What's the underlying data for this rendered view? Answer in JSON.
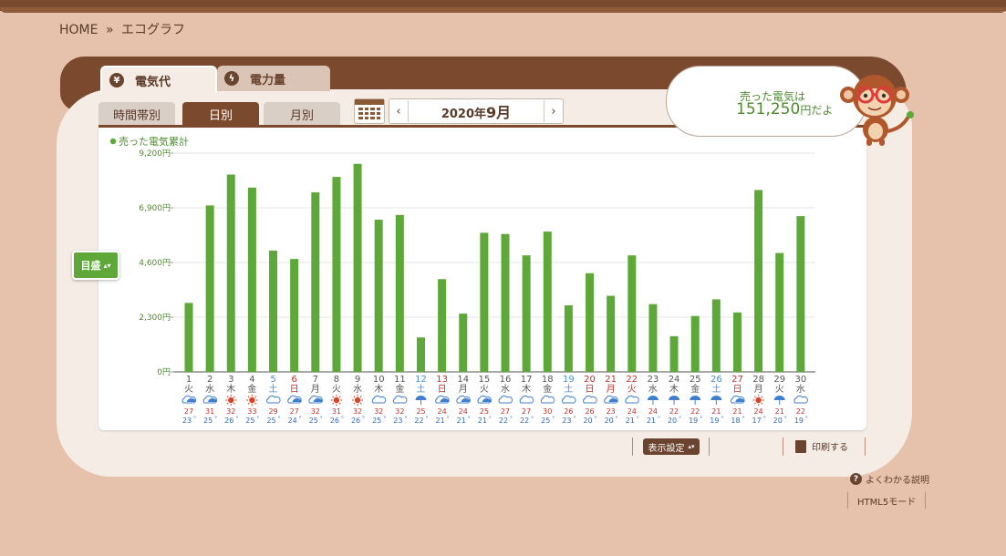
{
  "breadcrumb": {
    "home": "HOME",
    "separator": "»",
    "current": "エコグラフ"
  },
  "tabs": [
    {
      "label": "電気代",
      "icon": "yen-icon",
      "active": true
    },
    {
      "label": "電力量",
      "icon": "lightning-icon",
      "active": false
    }
  ],
  "subtabs": [
    {
      "label": "時間帯別",
      "active": false
    },
    {
      "label": "日別",
      "active": true
    },
    {
      "label": "月別",
      "active": false
    }
  ],
  "date_nav": {
    "year_text": "2020年",
    "month_text": "9月",
    "prev": "‹",
    "next": "›"
  },
  "summary": {
    "line1": "売った電気は",
    "amount": "151,250",
    "suffix": "円だよ"
  },
  "scale_button": "目盛",
  "footer": {
    "display_settings": "表示設定",
    "print": "印刷する",
    "help": "よくわかる説明",
    "html5": "HTML5モード"
  },
  "chart_data": {
    "type": "bar",
    "legend": "売った電気累計",
    "ylim": [
      0,
      9200
    ],
    "yticks": [
      "0円",
      "2,300円",
      "4,600円",
      "6,900円",
      "9,200円"
    ],
    "bar_color": "#5ea83a",
    "values": [
      2900,
      7000,
      8300,
      7750,
      5100,
      4750,
      7550,
      8200,
      8750,
      6400,
      6600,
      1450,
      3900,
      2450,
      5850,
      5800,
      4900,
      5900,
      2800,
      4150,
      3200,
      4900,
      2850,
      1500,
      2350,
      3050,
      2500,
      7650,
      5000,
      6550
    ],
    "days": [
      {
        "d": "1",
        "w": "火",
        "t": "n",
        "wx": "rain",
        "hi": "27",
        "lo": "23"
      },
      {
        "d": "2",
        "w": "水",
        "t": "n",
        "wx": "rain",
        "hi": "31",
        "lo": "25"
      },
      {
        "d": "3",
        "w": "木",
        "t": "n",
        "wx": "sun",
        "hi": "32",
        "lo": "26"
      },
      {
        "d": "4",
        "w": "金",
        "t": "n",
        "wx": "sun",
        "hi": "33",
        "lo": "25"
      },
      {
        "d": "5",
        "w": "土",
        "t": "sat",
        "wx": "cloud",
        "hi": "29",
        "lo": "25"
      },
      {
        "d": "6",
        "w": "日",
        "t": "sun",
        "wx": "rain",
        "hi": "27",
        "lo": "24"
      },
      {
        "d": "7",
        "w": "月",
        "t": "n",
        "wx": "rain",
        "hi": "32",
        "lo": "25"
      },
      {
        "d": "8",
        "w": "火",
        "t": "n",
        "wx": "sun",
        "hi": "31",
        "lo": "26"
      },
      {
        "d": "9",
        "w": "水",
        "t": "n",
        "wx": "sun",
        "hi": "32",
        "lo": "26"
      },
      {
        "d": "10",
        "w": "木",
        "t": "n",
        "wx": "cloud",
        "hi": "32",
        "lo": "25"
      },
      {
        "d": "11",
        "w": "金",
        "t": "n",
        "wx": "cloud",
        "hi": "32",
        "lo": "23"
      },
      {
        "d": "12",
        "w": "土",
        "t": "sat",
        "wx": "umbrella",
        "hi": "25",
        "lo": "22"
      },
      {
        "d": "13",
        "w": "日",
        "t": "sun",
        "wx": "rain",
        "hi": "24",
        "lo": "21"
      },
      {
        "d": "14",
        "w": "月",
        "t": "n",
        "wx": "rain",
        "hi": "24",
        "lo": "21"
      },
      {
        "d": "15",
        "w": "火",
        "t": "n",
        "wx": "rain",
        "hi": "25",
        "lo": "21"
      },
      {
        "d": "16",
        "w": "水",
        "t": "n",
        "wx": "cloud",
        "hi": "27",
        "lo": "22"
      },
      {
        "d": "17",
        "w": "木",
        "t": "n",
        "wx": "cloud",
        "hi": "27",
        "lo": "22"
      },
      {
        "d": "18",
        "w": "金",
        "t": "n",
        "wx": "cloud",
        "hi": "30",
        "lo": "25"
      },
      {
        "d": "19",
        "w": "土",
        "t": "sat",
        "wx": "cloud",
        "hi": "26",
        "lo": "23"
      },
      {
        "d": "20",
        "w": "日",
        "t": "sun",
        "wx": "cloud",
        "hi": "26",
        "lo": "20"
      },
      {
        "d": "21",
        "w": "月",
        "t": "sun",
        "wx": "rain",
        "hi": "23",
        "lo": "20"
      },
      {
        "d": "22",
        "w": "火",
        "t": "sun",
        "wx": "cloud",
        "hi": "24",
        "lo": "21"
      },
      {
        "d": "23",
        "w": "水",
        "t": "n",
        "wx": "umbrella",
        "hi": "24",
        "lo": "21"
      },
      {
        "d": "24",
        "w": "木",
        "t": "n",
        "wx": "umbrella",
        "hi": "22",
        "lo": "20"
      },
      {
        "d": "25",
        "w": "金",
        "t": "n",
        "wx": "umbrella",
        "hi": "22",
        "lo": "19"
      },
      {
        "d": "26",
        "w": "土",
        "t": "sat",
        "wx": "umbrella",
        "hi": "21",
        "lo": "19"
      },
      {
        "d": "27",
        "w": "日",
        "t": "sun",
        "wx": "rain",
        "hi": "21",
        "lo": "18"
      },
      {
        "d": "28",
        "w": "月",
        "t": "n",
        "wx": "sun",
        "hi": "24",
        "lo": "17"
      },
      {
        "d": "29",
        "w": "火",
        "t": "n",
        "wx": "umbrella",
        "hi": "21",
        "lo": "20"
      },
      {
        "d": "30",
        "w": "水",
        "t": "n",
        "wx": "cloud",
        "hi": "22",
        "lo": "19"
      }
    ]
  }
}
